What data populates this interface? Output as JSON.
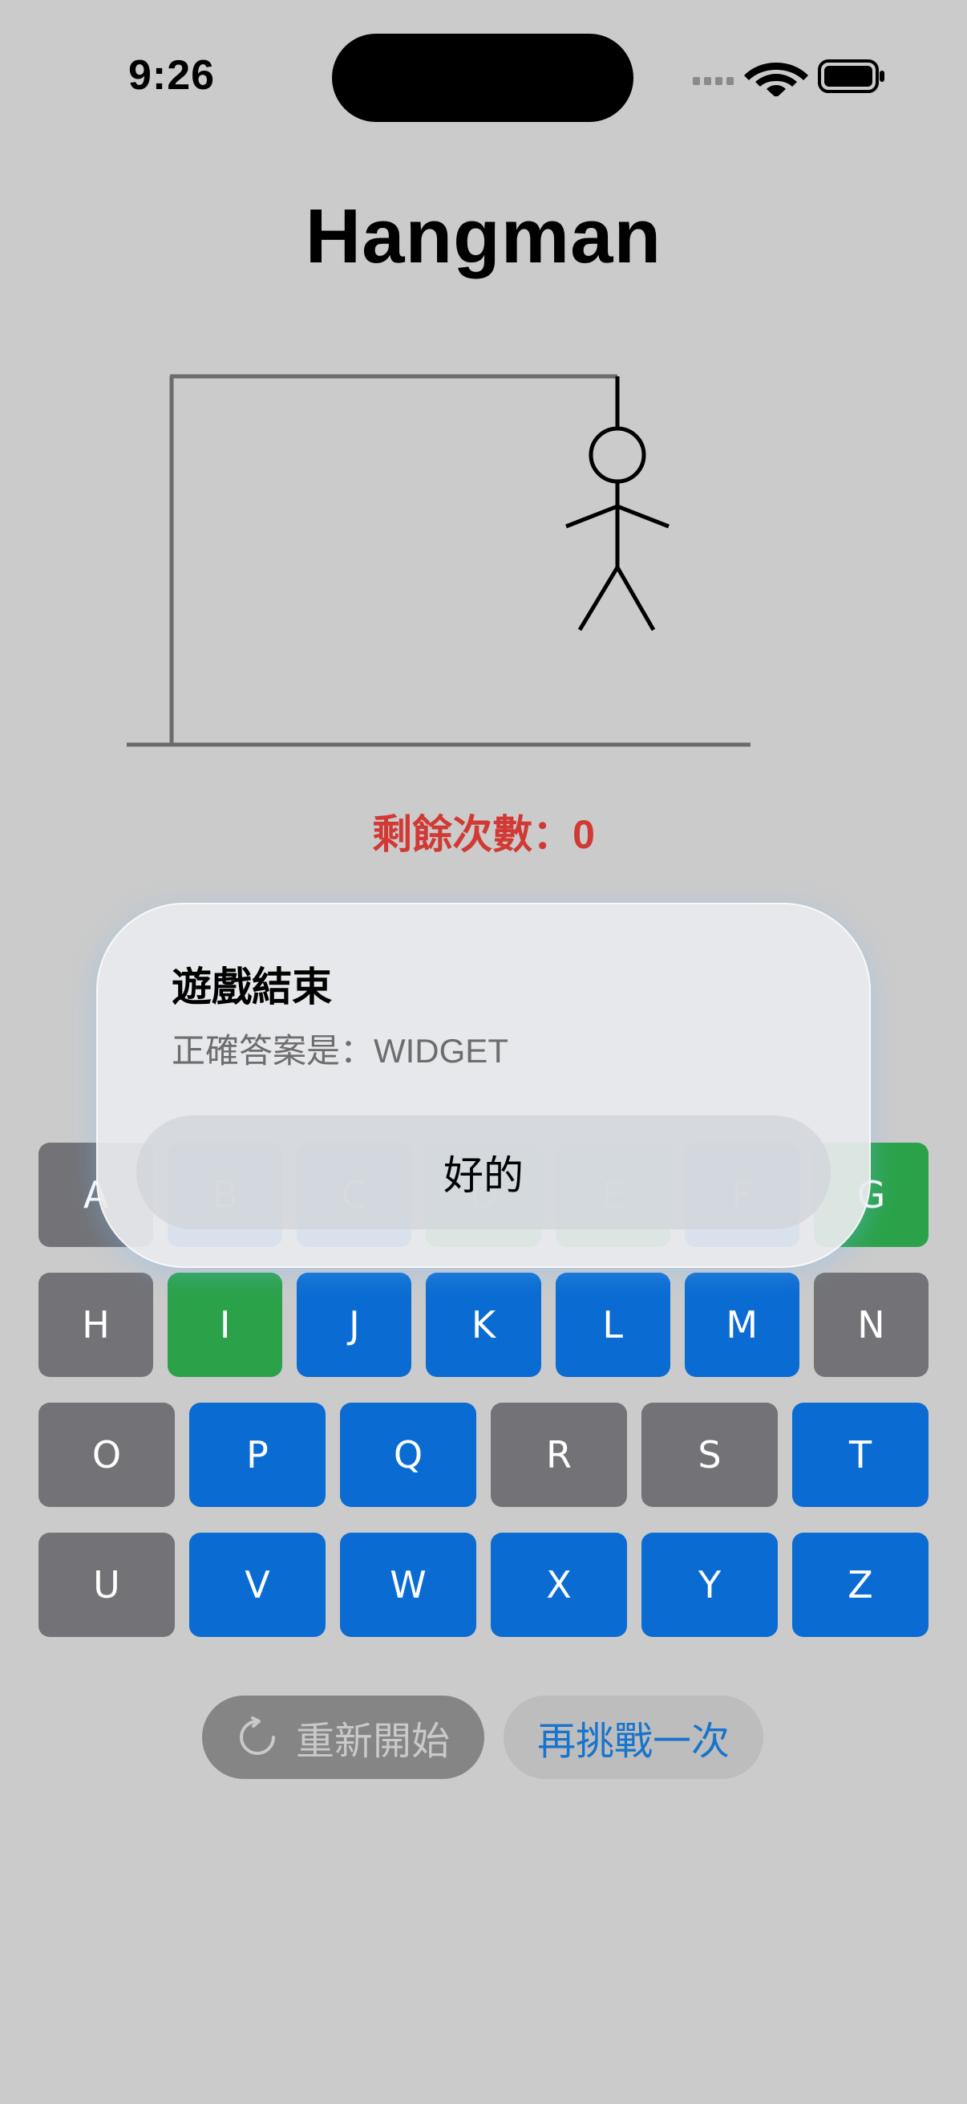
{
  "status_bar": {
    "time": "9:26"
  },
  "app": {
    "title": "Hangman"
  },
  "game": {
    "remaining_label": "剩餘次數：",
    "remaining_count": "0"
  },
  "keyboard": {
    "rows": [
      [
        {
          "letter": "A",
          "state": "gray"
        },
        {
          "letter": "B",
          "state": "blue"
        },
        {
          "letter": "C",
          "state": "blue"
        },
        {
          "letter": "D",
          "state": "green"
        },
        {
          "letter": "E",
          "state": "green"
        },
        {
          "letter": "F",
          "state": "blue"
        },
        {
          "letter": "G",
          "state": "green"
        }
      ],
      [
        {
          "letter": "H",
          "state": "gray"
        },
        {
          "letter": "I",
          "state": "green"
        },
        {
          "letter": "J",
          "state": "blue"
        },
        {
          "letter": "K",
          "state": "blue"
        },
        {
          "letter": "L",
          "state": "blue"
        },
        {
          "letter": "M",
          "state": "blue"
        },
        {
          "letter": "N",
          "state": "gray"
        }
      ],
      [
        {
          "letter": "O",
          "state": "gray"
        },
        {
          "letter": "P",
          "state": "blue"
        },
        {
          "letter": "Q",
          "state": "blue"
        },
        {
          "letter": "R",
          "state": "gray"
        },
        {
          "letter": "S",
          "state": "gray"
        },
        {
          "letter": "T",
          "state": "blue"
        }
      ],
      [
        {
          "letter": "U",
          "state": "gray"
        },
        {
          "letter": "V",
          "state": "blue"
        },
        {
          "letter": "W",
          "state": "blue"
        },
        {
          "letter": "X",
          "state": "blue"
        },
        {
          "letter": "Y",
          "state": "blue"
        },
        {
          "letter": "Z",
          "state": "blue"
        }
      ]
    ]
  },
  "controls": {
    "restart_label": "重新開始",
    "retry_label": "再挑戰一次"
  },
  "dialog": {
    "title": "遊戲結束",
    "message": "正確答案是：WIDGET",
    "ok_label": "好的"
  },
  "colors": {
    "background": "#cbcbcb",
    "key_gray": "#737377",
    "key_blue": "#0a6cd2",
    "key_green": "#2ba24a",
    "remaining_red": "#d13a34",
    "retry_blue": "#1874cc"
  },
  "icons": {
    "signal": "cellular-signal-icon",
    "wifi": "wifi-icon",
    "battery": "battery-icon",
    "restart": "refresh-icon"
  }
}
